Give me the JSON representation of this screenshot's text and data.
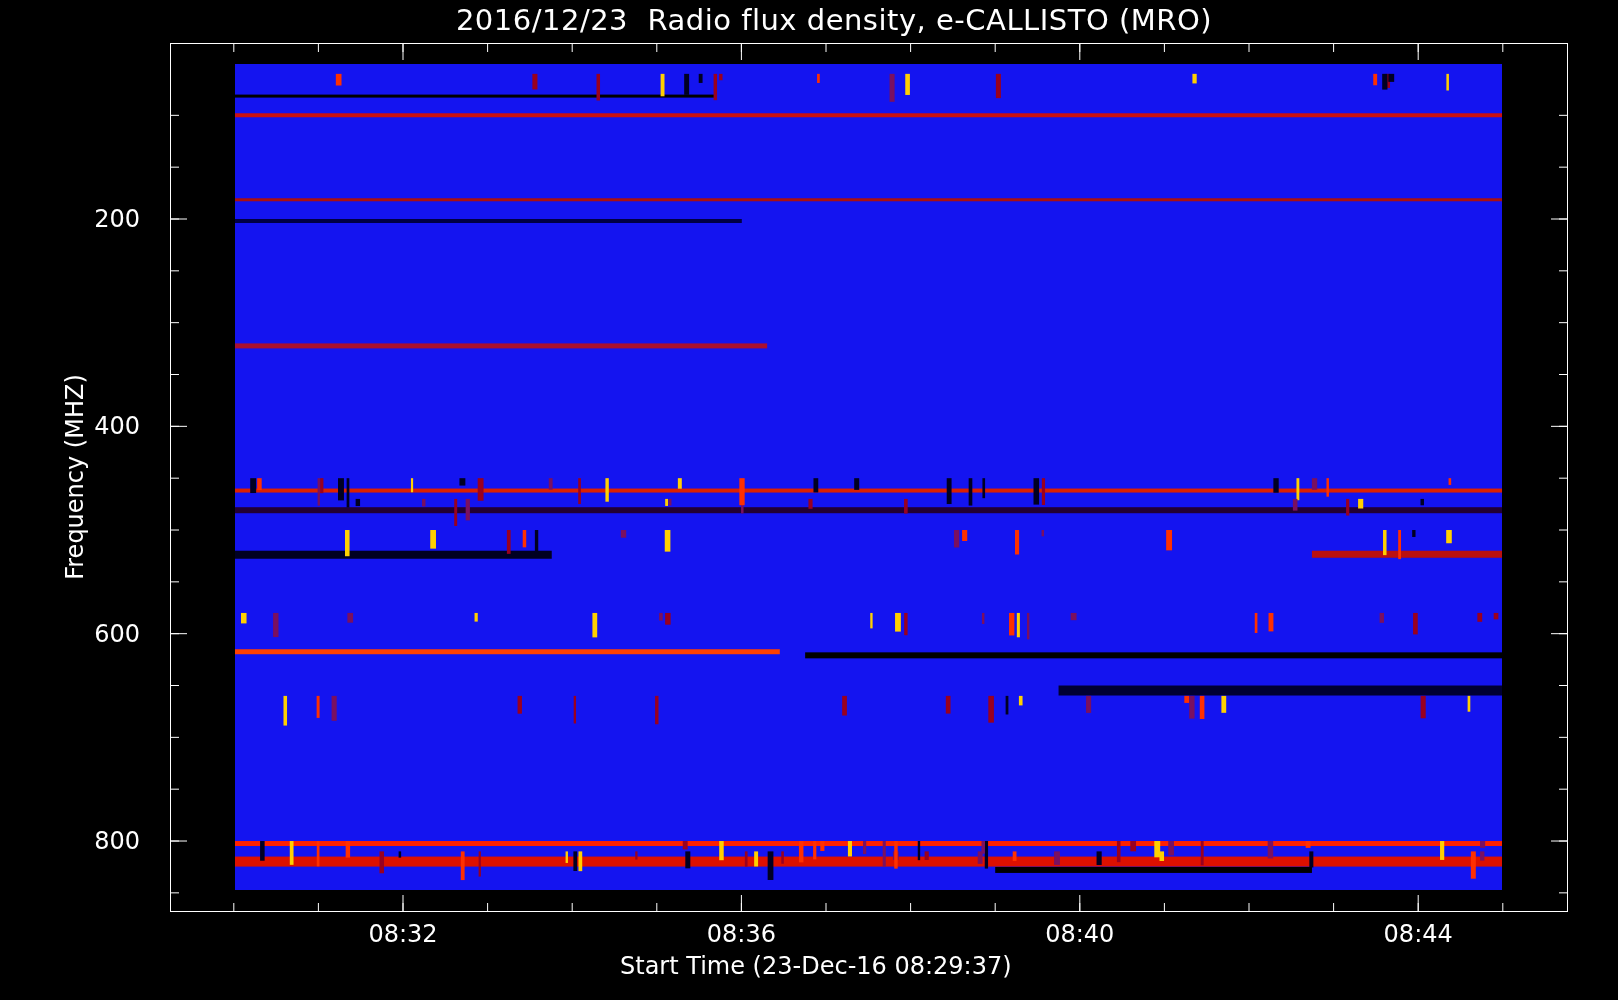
{
  "title": "2016/12/23  Radio flux density, e-CALLISTO (MRO)",
  "y_axis": {
    "label": "Frequency (MHZ)",
    "ticks": [
      "200",
      "400",
      "600",
      "800"
    ]
  },
  "x_axis": {
    "label": "Start Time (23-Dec-16 08:29:37)",
    "ticks": [
      "08:32",
      "08:36",
      "08:40",
      "08:44"
    ]
  }
}
